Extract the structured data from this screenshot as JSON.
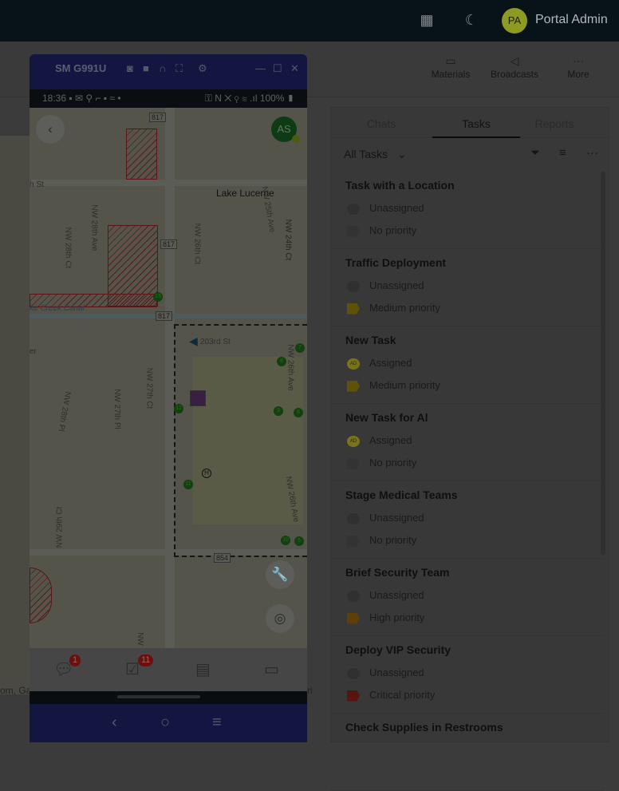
{
  "header": {
    "user_initials": "PA",
    "user_name": "Portal Admin",
    "qr_icon": "qr-code-icon",
    "theme_icon": "moon-icon"
  },
  "toolbar": {
    "items": [
      {
        "label": "Materials",
        "icon": "folder-icon"
      },
      {
        "label": "Broadcasts",
        "icon": "megaphone-icon"
      },
      {
        "label": "More",
        "icon": "more-icon"
      }
    ]
  },
  "panel": {
    "tabs": [
      "Chats",
      "Tasks",
      "Reports"
    ],
    "active_tab": "Tasks",
    "filter": "All Tasks",
    "tasks": [
      {
        "title": "Task with a Location",
        "assignment": "Unassigned",
        "priority": "No priority",
        "priority_color": "#333333"
      },
      {
        "title": "Traffic Deployment",
        "assignment": "Unassigned",
        "priority": "Medium priority",
        "priority_color": "#5e5208"
      },
      {
        "title": "New Task",
        "assignment": "Assigned",
        "assignee_initials": "AD",
        "priority": "Medium priority",
        "priority_color": "#5e5208"
      },
      {
        "title": "New Task for Al",
        "assignment": "Assigned",
        "assignee_initials": "AD",
        "priority": "No priority",
        "priority_color": "#333333"
      },
      {
        "title": "Stage Medical Teams",
        "assignment": "Unassigned",
        "priority": "No priority",
        "priority_color": "#333333"
      },
      {
        "title": "Brief Security Team",
        "assignment": "Unassigned",
        "priority": "High priority",
        "priority_color": "#5e3f08"
      },
      {
        "title": "Deploy VIP Security",
        "assignment": "Unassigned",
        "priority": "Critical priority",
        "priority_color": "#5a1410"
      },
      {
        "title": "Check Supplies in Restrooms"
      }
    ]
  },
  "attribution": "om, Ga",
  "attribution_right": "ri",
  "phone": {
    "device": "SM G991U",
    "time": "18:36",
    "battery": "100%",
    "avatar": "AS",
    "map": {
      "place": "Lake Lucerne",
      "streets": [
        "h St",
        "NW 28th Ct",
        "NW 28th Ave",
        "NW 26th Ct",
        "NW 25th Ave",
        "NW 24th Ct",
        "ke Creek Canal",
        "203rd St",
        "er",
        "NW 28th Pl",
        "NW 27th Pl",
        "NW 27th Ct",
        "NW 26th Ave",
        "NW 26th Ave",
        "NW 29th Ct",
        "NW"
      ],
      "shields": [
        "817",
        "817",
        "817",
        "854"
      ],
      "markers": [
        "19",
        "7",
        "8",
        "12",
        "9",
        "6",
        "11",
        "10",
        "5"
      ],
      "h_label": "H"
    },
    "badges": {
      "chats": "1",
      "tasks": "11"
    }
  }
}
